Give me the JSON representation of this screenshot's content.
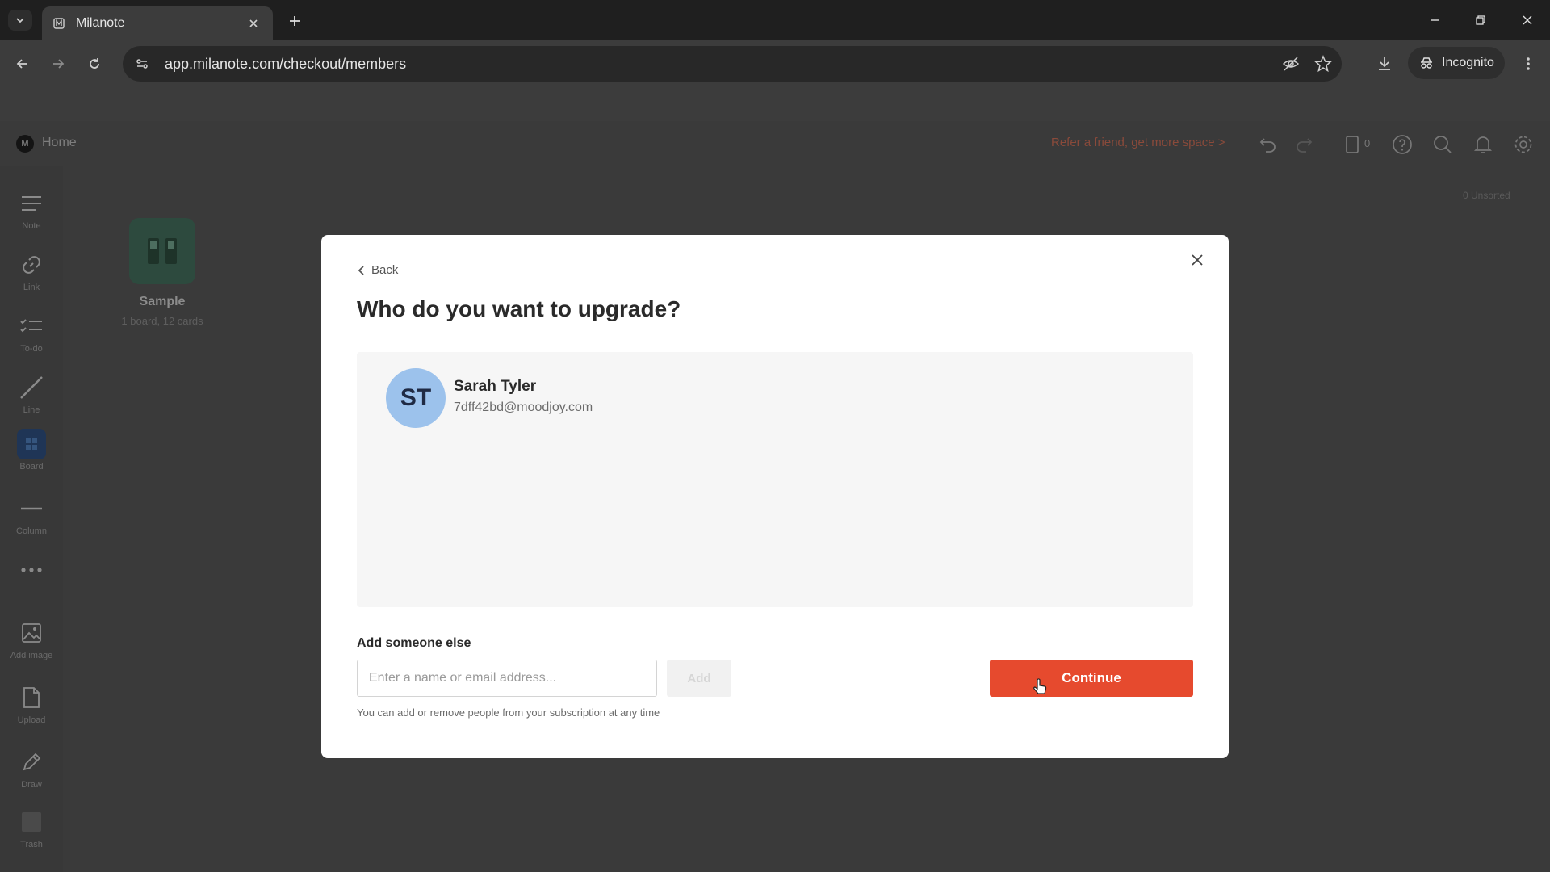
{
  "browser": {
    "tab_title": "Milanote",
    "url": "app.milanote.com/checkout/members",
    "incognito_label": "Incognito"
  },
  "app_header": {
    "home_label": "Home",
    "refer_text": "Refer a friend, get more space >",
    "device_count": "0"
  },
  "sidebar": {
    "tools": [
      {
        "label": "Note",
        "icon": "note-icon"
      },
      {
        "label": "Link",
        "icon": "link-icon"
      },
      {
        "label": "To-do",
        "icon": "todo-icon"
      },
      {
        "label": "Line",
        "icon": "line-icon"
      },
      {
        "label": "Board",
        "icon": "board-icon"
      },
      {
        "label": "Column",
        "icon": "column-icon"
      },
      {
        "label": "",
        "icon": "more-icon"
      },
      {
        "label": "Add image",
        "icon": "image-icon"
      },
      {
        "label": "Upload",
        "icon": "upload-icon"
      },
      {
        "label": "Draw",
        "icon": "pen-icon"
      },
      {
        "label": "Trash",
        "icon": "trash-icon"
      }
    ]
  },
  "canvas": {
    "sample_title": "Sample",
    "sample_meta": "1 board, 12 cards",
    "unsorted_label": "0 Unsorted"
  },
  "modal": {
    "back_label": "Back",
    "title": "Who do you want to upgrade?",
    "member": {
      "initials": "ST",
      "name": "Sarah Tyler",
      "email": "7dff42bd@moodjoy.com"
    },
    "add_label": "Add someone else",
    "input_placeholder": "Enter a name or email address...",
    "add_button": "Add",
    "hint": "You can add or remove people from your subscription at any time",
    "continue_button": "Continue"
  },
  "colors": {
    "accent": "#e64a2e",
    "avatar": "#9cc2ec",
    "refer_link": "#8a4a3a"
  }
}
